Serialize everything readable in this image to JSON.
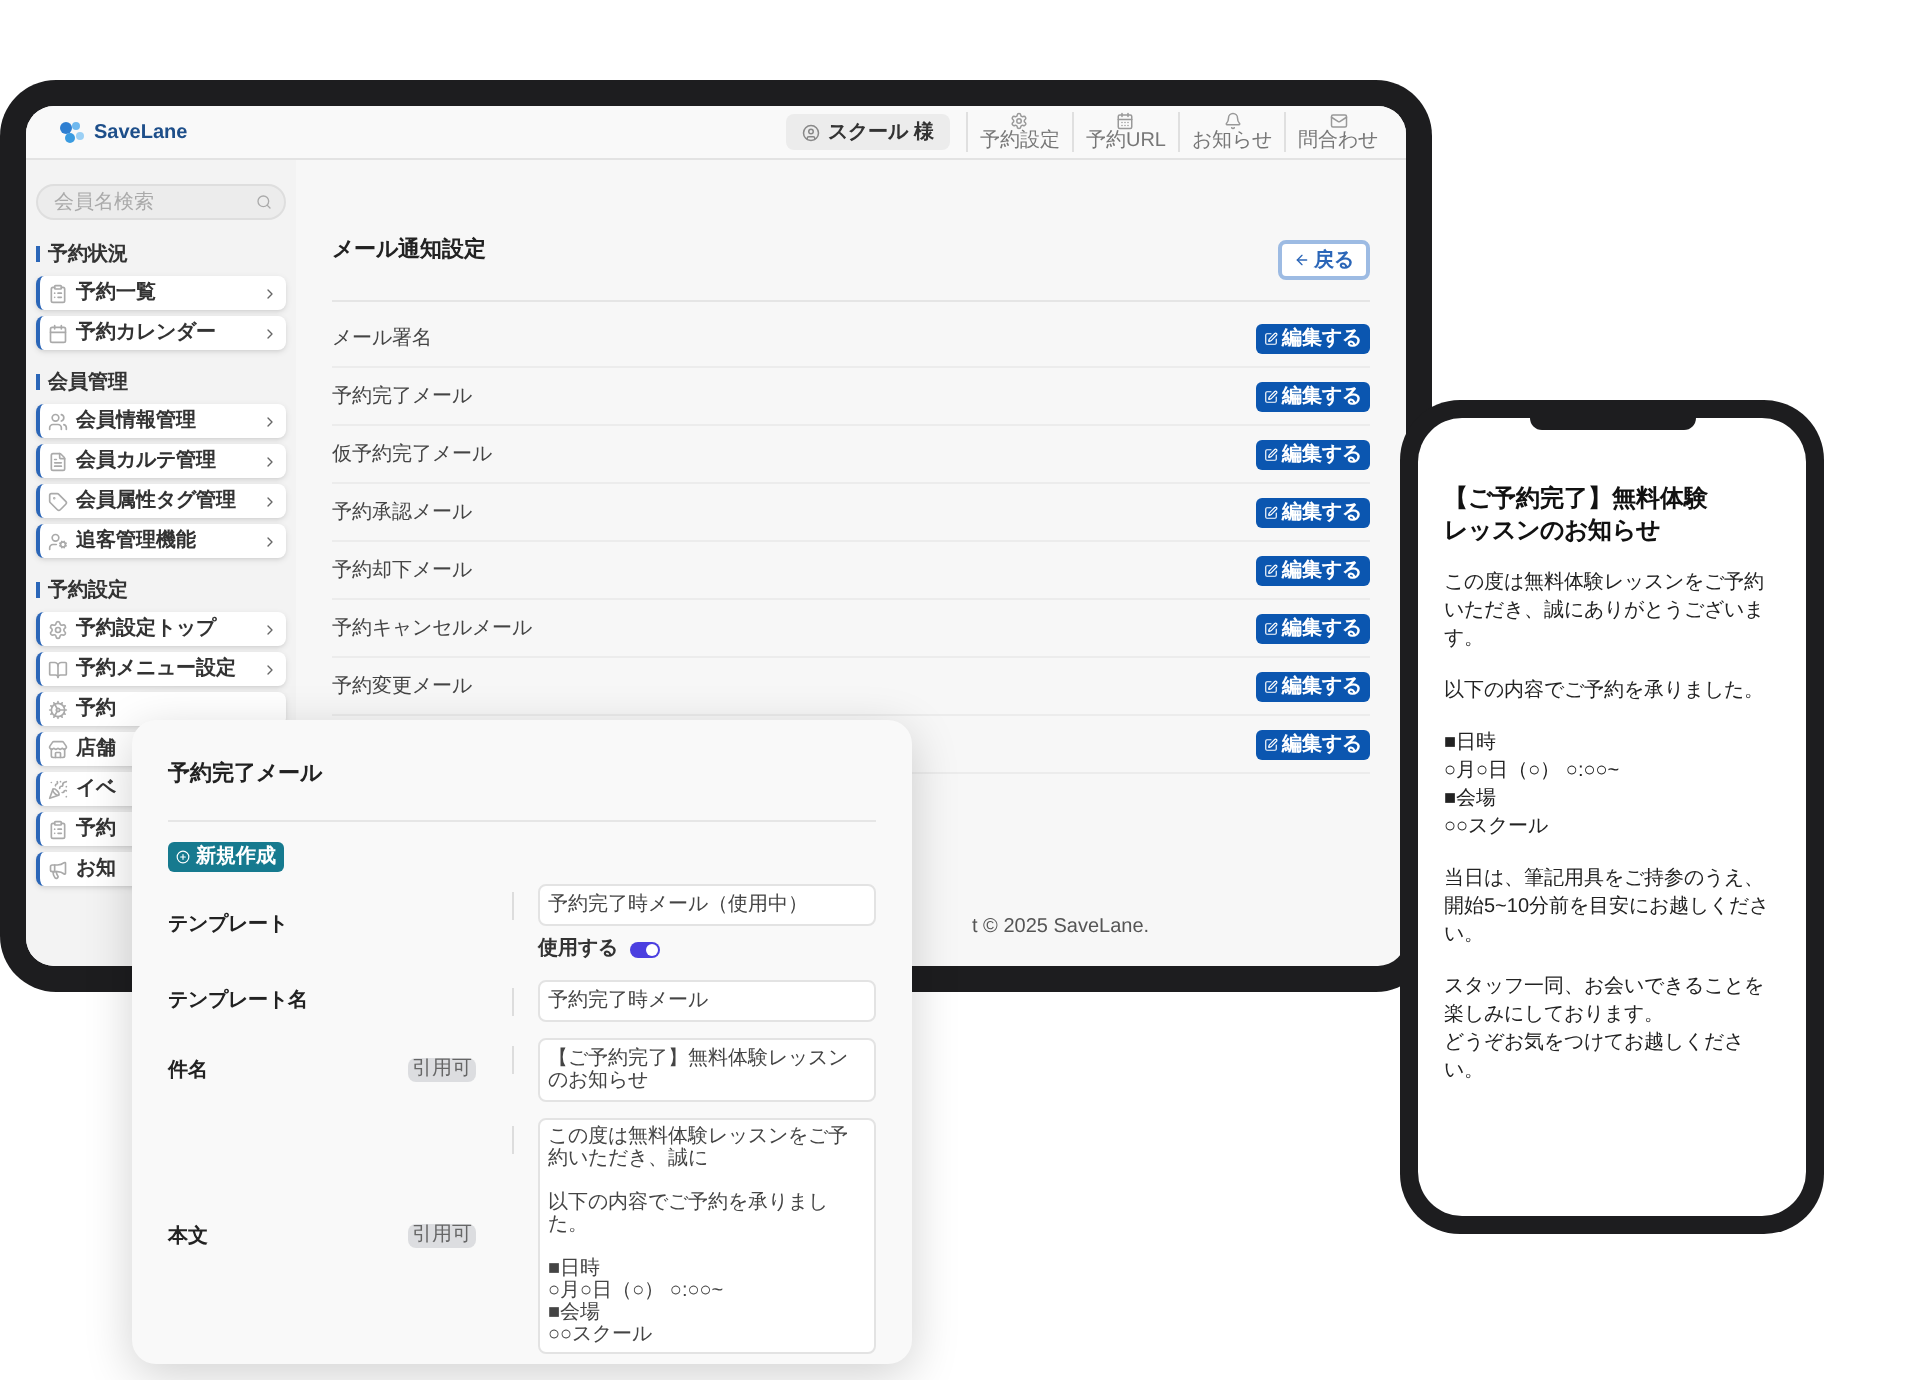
{
  "tablet": {
    "header": {
      "logo": "SaveLane",
      "user": "スクール 様",
      "nav": [
        {
          "label": "予約設定"
        },
        {
          "label": "予約URL"
        },
        {
          "label": "お知らせ"
        },
        {
          "label": "問合わせ"
        }
      ]
    },
    "sidebar": {
      "search": {
        "placeholder": "会員名検索"
      },
      "sections": [
        {
          "title": "予約状況",
          "items": [
            {
              "label": "予約一覧",
              "chevron": true
            },
            {
              "label": "予約カレンダー",
              "chevron": true
            }
          ]
        },
        {
          "title": "会員管理",
          "items": [
            {
              "label": "会員情報管理",
              "chevron": true
            },
            {
              "label": "会員カルテ管理",
              "chevron": true
            },
            {
              "label": "会員属性タグ管理",
              "chevron": true
            },
            {
              "label": "追客管理機能",
              "chevron": true
            }
          ]
        },
        {
          "title": "予約設定",
          "items": [
            {
              "label": "予約設定トップ",
              "chevron": true
            },
            {
              "label": "予約メニュー設定",
              "chevron": true
            },
            {
              "label": "予約"
            },
            {
              "label": "店舗"
            },
            {
              "label": "イベ"
            },
            {
              "label": "予約"
            },
            {
              "label": "お知"
            }
          ]
        }
      ]
    },
    "main": {
      "title": "メール通知設定",
      "back_button": "戻る",
      "rows": [
        {
          "label": "メール署名",
          "button": "編集する"
        },
        {
          "label": "予約完了メール",
          "button": "編集する"
        },
        {
          "label": "仮予約完了メール",
          "button": "編集する"
        },
        {
          "label": "予約承認メール",
          "button": "編集する"
        },
        {
          "label": "予約却下メール",
          "button": "編集する"
        },
        {
          "label": "予約キャンセルメール",
          "button": "編集する"
        },
        {
          "label": "予約変更メール",
          "button": "編集する"
        },
        {
          "button": "編集する"
        }
      ],
      "footer": "t © 2025 SaveLane."
    }
  },
  "template_card": {
    "title": "予約完了メール",
    "new_button": "新規作成",
    "fields": [
      {
        "kind": "text",
        "label": "テンプレート",
        "value": "予約完了時メール（使用中）",
        "toggle": {
          "label": "使用する",
          "on": true
        }
      },
      {
        "kind": "text",
        "label": "テンプレート名",
        "value": "予約完了時メール"
      },
      {
        "kind": "text",
        "label": "件名",
        "tag": "引用可",
        "value": "【ご予約完了】無料体験レッスンのお知らせ"
      },
      {
        "kind": "textarea",
        "label": "本文",
        "tag": "引用可",
        "paragraphs": [
          [
            "この度は無料体験レッスンをご予約いただき、誠に"
          ],
          [
            "以下の内容でご予約を承りました。"
          ],
          [
            "■日時",
            "○月○日（○） ○:○○~",
            "■会場",
            "○○スクール"
          ]
        ]
      }
    ]
  },
  "phone": {
    "title_lines": [
      "【ご予約完了】無料体験",
      "レッスンのお知らせ"
    ],
    "paragraphs": [
      [
        "この度は無料体験レッスンをご予約いただき、誠にありがとうございます。"
      ],
      [
        "以下の内容でご予約を承りました。"
      ],
      [
        "■日時",
        "○月○日（○） ○:○○~",
        "■会場",
        "○○スクール"
      ],
      [
        "当日は、筆記用具をご持参のうえ、開始5~10分前を目安にお越しください。"
      ],
      [
        "スタッフ一同、お会いできることを楽しみにしております。",
        "どうぞお気をつけてお越しください。"
      ]
    ]
  }
}
